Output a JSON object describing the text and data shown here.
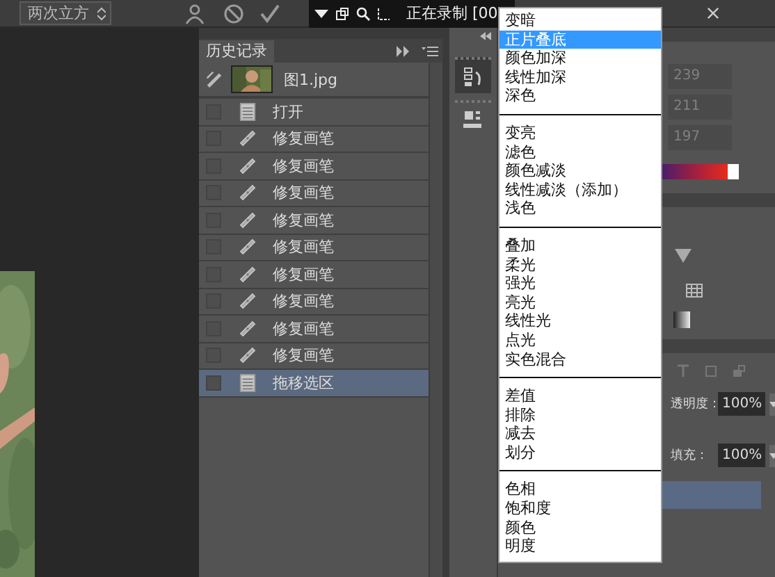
{
  "toolbar": {
    "interpolation": "两次立方",
    "recording": "正在录制 [00"
  },
  "history_panel": {
    "tab": "历史记录",
    "snapshot": {
      "name": "图1.jpg"
    },
    "steps": [
      {
        "label": "打开",
        "kind": "document",
        "selected": false
      },
      {
        "label": "修复画笔",
        "kind": "healing",
        "selected": false
      },
      {
        "label": "修复画笔",
        "kind": "healing",
        "selected": false
      },
      {
        "label": "修复画笔",
        "kind": "healing",
        "selected": false
      },
      {
        "label": "修复画笔",
        "kind": "healing",
        "selected": false
      },
      {
        "label": "修复画笔",
        "kind": "healing",
        "selected": false
      },
      {
        "label": "修复画笔",
        "kind": "healing",
        "selected": false
      },
      {
        "label": "修复画笔",
        "kind": "healing",
        "selected": false
      },
      {
        "label": "修复画笔",
        "kind": "healing",
        "selected": false
      },
      {
        "label": "修复画笔",
        "kind": "healing",
        "selected": false
      },
      {
        "label": "拖移选区",
        "kind": "document",
        "selected": true
      }
    ]
  },
  "blend_menu": {
    "groups": [
      {
        "items": [
          {
            "label": "变暗",
            "selected": false
          },
          {
            "label": "正片叠底",
            "selected": true
          },
          {
            "label": "颜色加深",
            "selected": false
          },
          {
            "label": "线性加深",
            "selected": false
          },
          {
            "label": "深色",
            "selected": false
          }
        ]
      },
      {
        "items": [
          {
            "label": "变亮",
            "selected": false
          },
          {
            "label": "滤色",
            "selected": false
          },
          {
            "label": "颜色减淡",
            "selected": false
          },
          {
            "label": "线性减淡（添加）",
            "selected": false
          },
          {
            "label": "浅色",
            "selected": false
          }
        ]
      },
      {
        "items": [
          {
            "label": "叠加",
            "selected": false
          },
          {
            "label": "柔光",
            "selected": false
          },
          {
            "label": "强光",
            "selected": false
          },
          {
            "label": "亮光",
            "selected": false
          },
          {
            "label": "线性光",
            "selected": false
          },
          {
            "label": "点光",
            "selected": false
          },
          {
            "label": "实色混合",
            "selected": false
          }
        ]
      },
      {
        "items": [
          {
            "label": "差值",
            "selected": false
          },
          {
            "label": "排除",
            "selected": false
          },
          {
            "label": "减去",
            "selected": false
          },
          {
            "label": "划分",
            "selected": false
          }
        ]
      },
      {
        "items": [
          {
            "label": "色相",
            "selected": false
          },
          {
            "label": "饱和度",
            "selected": false
          },
          {
            "label": "颜色",
            "selected": false
          },
          {
            "label": "明度",
            "selected": false
          }
        ]
      }
    ]
  },
  "color_panel": {
    "values": [
      "239",
      "211",
      "197"
    ]
  },
  "layers_panel": {
    "opacity_label": "透明度：",
    "opacity": "100%",
    "fill_label": "填充：",
    "fill": "100%"
  }
}
